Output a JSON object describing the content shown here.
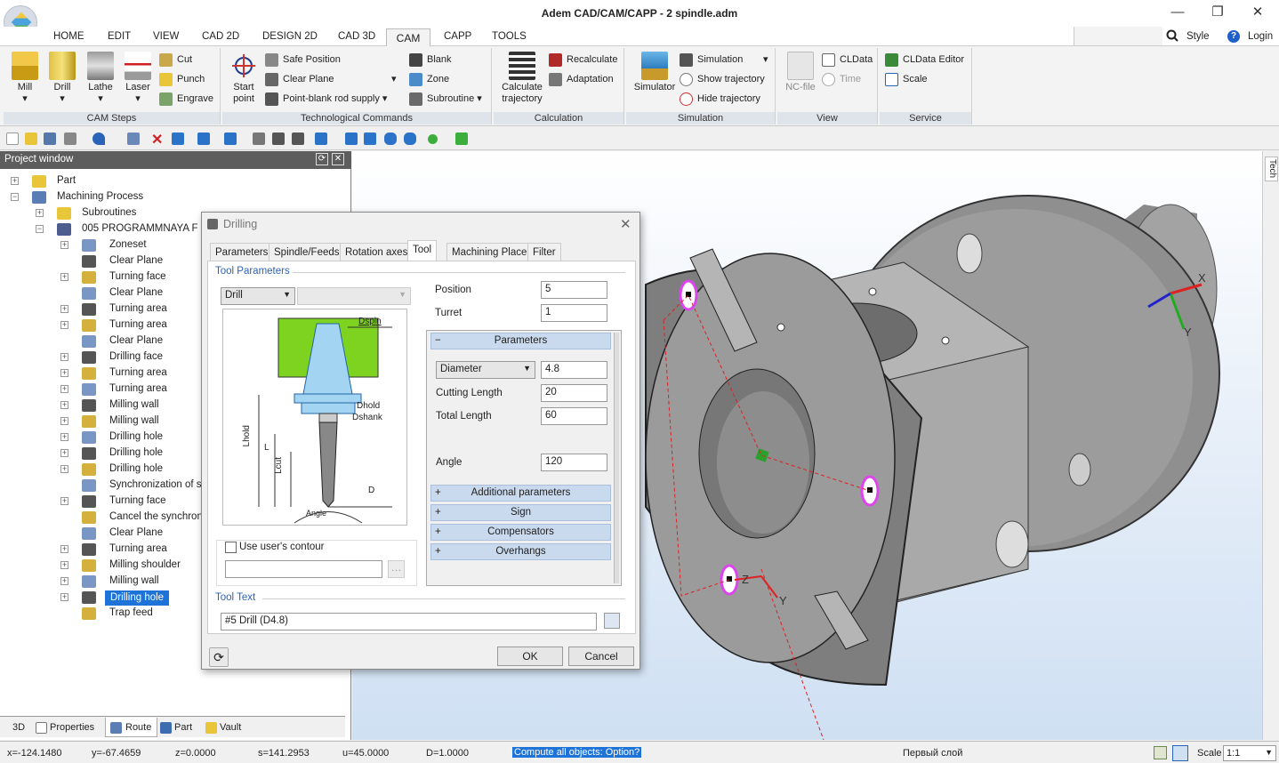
{
  "window": {
    "title": "Adem CAD/CAM/CAPP - 2 spindle.adm",
    "min": "—",
    "max": "❐",
    "close": "✕"
  },
  "menu": [
    "HOME",
    "EDIT",
    "VIEW",
    "CAD 2D",
    "DESIGN 2D",
    "CAD 3D",
    "CAM",
    "CAPP",
    "TOOLS"
  ],
  "account": {
    "style": "Style",
    "login": "Login",
    "help": "?"
  },
  "ribbon": {
    "cam_steps": {
      "label": "CAM Steps",
      "mill": "Mill",
      "drill": "Drill",
      "lathe": "Lathe",
      "laser": "Laser",
      "cut": "Cut",
      "punch": "Punch",
      "engrave": "Engrave"
    },
    "tech": {
      "label": "Technological Commands",
      "start": "Start",
      "point": "point",
      "safe": "Safe Position",
      "clear": "Clear Plane",
      "pointblank": "Point-blank rod supply",
      "blank": "Blank",
      "zone": "Zone",
      "subroutine": "Subroutine"
    },
    "calc": {
      "label": "Calculation",
      "calc1": "Calculate",
      "calc2": "trajectory",
      "recalculate": "Recalculate",
      "adaptation": "Adaptation"
    },
    "sim": {
      "label": "Simulation",
      "simulator": "Simulator",
      "simulation": "Simulation",
      "show": "Show trajectory",
      "hide": "Hide trajectory"
    },
    "view": {
      "label": "View",
      "ncfile": "NC-file",
      "cldata": "CLData",
      "time": "Time"
    },
    "service": {
      "label": "Service",
      "editor": "CLData Editor",
      "scale": "Scale"
    }
  },
  "project": {
    "title": "Project window",
    "tree": [
      {
        "label": "Part",
        "level": 0,
        "exp": "+"
      },
      {
        "label": "Machining Process",
        "level": 0,
        "exp": "−"
      },
      {
        "label": "Subroutines",
        "level": 1,
        "exp": "+"
      },
      {
        "label": "005  PROGRAMMNAYA F",
        "level": 1,
        "exp": "−"
      },
      {
        "label": "Zoneset",
        "level": 2,
        "exp": "+"
      },
      {
        "label": "Clear Plane",
        "level": 2,
        "exp": ""
      },
      {
        "label": "Turning face",
        "level": 2,
        "exp": "+"
      },
      {
        "label": "Clear Plane",
        "level": 2,
        "exp": ""
      },
      {
        "label": "Turning  area",
        "level": 2,
        "exp": "+"
      },
      {
        "label": "Turning  area",
        "level": 2,
        "exp": "+"
      },
      {
        "label": "Clear Plane",
        "level": 2,
        "exp": ""
      },
      {
        "label": "Drilling face",
        "level": 2,
        "exp": "+"
      },
      {
        "label": "Turning  area",
        "level": 2,
        "exp": "+"
      },
      {
        "label": "Turning  area",
        "level": 2,
        "exp": "+"
      },
      {
        "label": "Milling  wall",
        "level": 2,
        "exp": "+"
      },
      {
        "label": "Milling  wall",
        "level": 2,
        "exp": "+"
      },
      {
        "label": "Drilling  hole",
        "level": 2,
        "exp": "+"
      },
      {
        "label": "Drilling  hole",
        "level": 2,
        "exp": "+"
      },
      {
        "label": "Drilling  hole",
        "level": 2,
        "exp": "+"
      },
      {
        "label": "Synchronization of spi",
        "level": 2,
        "exp": ""
      },
      {
        "label": "Turning  face",
        "level": 2,
        "exp": "+"
      },
      {
        "label": "Cancel the synchroniz",
        "level": 2,
        "exp": ""
      },
      {
        "label": "Clear Plane",
        "level": 2,
        "exp": ""
      },
      {
        "label": "Turning  area",
        "level": 2,
        "exp": "+"
      },
      {
        "label": "Milling  shoulder",
        "level": 2,
        "exp": "+"
      },
      {
        "label": "Milling  wall",
        "level": 2,
        "exp": "+"
      },
      {
        "label": "Drilling  hole",
        "level": 2,
        "exp": "+",
        "selected": true
      },
      {
        "label": "Trap feed",
        "level": 2,
        "exp": ""
      }
    ]
  },
  "bottom_tabs": [
    "3D",
    "Properties",
    "Route",
    "Part",
    "Vault"
  ],
  "dialog": {
    "title": "Drilling",
    "tabs": [
      "Parameters",
      "Spindle/Feeds",
      "Rotation axes",
      "Tool",
      "Machining Place",
      "Filter"
    ],
    "section_tool": "Tool Parameters",
    "tool_type": "Drill",
    "position_label": "Position",
    "position": "5",
    "turret_label": "Turret",
    "turret": "1",
    "params_header": "Parameters",
    "diameter_label": "Diameter",
    "diameter": "4.8",
    "cutting_label": "Cutting Length",
    "cutting": "20",
    "total_label": "Total Length",
    "total": "60",
    "angle_label": "Angle",
    "angle": "120",
    "panels": [
      "Additional parameters",
      "Sign",
      "Compensators",
      "Overhangs"
    ],
    "contour": "Use user's contour",
    "section_text": "Tool Text",
    "tool_text": "#5 Drill (D4.8)",
    "ok": "OK",
    "cancel": "Cancel",
    "diagram": {
      "dspin": "Dspin",
      "dhold": "Dhold",
      "dshank": "Dshank",
      "lhold": "Lhold",
      "l": "L",
      "lcut": "Lcut",
      "d": "D",
      "angle": "Angle"
    }
  },
  "viewport": {
    "axis_x": "X",
    "axis_y": "Y",
    "axis_z": "Z",
    "side_tab": "Tech"
  },
  "status": {
    "x": "x=-124.1480",
    "y": "y=-67.4659",
    "z": "z=0.0000",
    "s": "s=141.2953",
    "u": "u=45.0000",
    "d": "D=1.0000",
    "prompt": "Compute all objects: Option?",
    "layer": "Первый слой",
    "scale_label": "Scale",
    "scale": "1:1"
  },
  "colors": {
    "accent": "#0a78d7",
    "selected": "#1e73d9",
    "group": "#dfe3ea",
    "panel": "#c9d9ee"
  }
}
